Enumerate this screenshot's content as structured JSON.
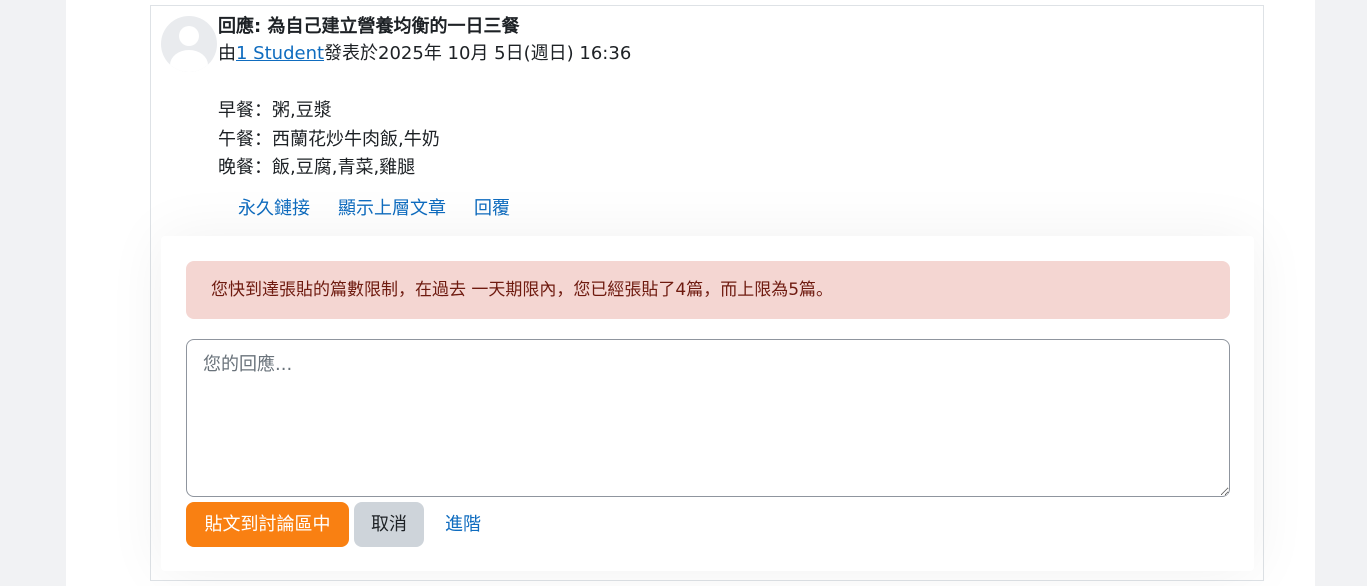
{
  "post": {
    "title": "回應: 為自己建立營養均衡的一日三餐",
    "meta_prefix": "由",
    "author": "1 Student",
    "meta_suffix": "發表於2025年 10月 5日(週日) 16:36",
    "body_lines": [
      "早餐：粥,豆漿",
      "午餐：西蘭花炒牛肉飯,牛奶",
      "晚餐：飯,豆腐,青菜,雞腿"
    ],
    "actions": {
      "permalink": "永久鏈接",
      "show_parent": "顯示上層文章",
      "reply": "回覆"
    }
  },
  "reply_form": {
    "alert": "您快到達張貼的篇數限制，在過去 一天期限內，您已經張貼了4篇，而上限為5篇。",
    "textarea_placeholder": "您的回應...",
    "textarea_value": "",
    "submit_label": "貼文到討論區中",
    "cancel_label": "取消",
    "advanced_label": "進階"
  },
  "colors": {
    "page_background": "#f1f2f4",
    "link": "#0f6cbf",
    "primary_button": "#f98012",
    "secondary_button": "#ced4da",
    "alert_background": "#f4d6d2",
    "alert_text": "#6e1a0f"
  },
  "icons": {
    "avatar": "default-user-avatar-icon"
  }
}
